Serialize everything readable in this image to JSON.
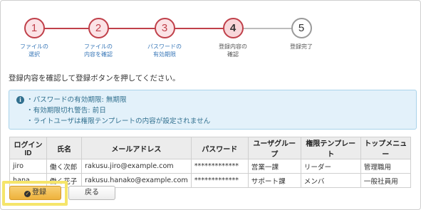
{
  "stepper": {
    "steps": [
      {
        "number": "1",
        "label": "ファイルの\n選択",
        "state": "past"
      },
      {
        "number": "2",
        "label": "ファイルの\n内容を確認",
        "state": "past"
      },
      {
        "number": "3",
        "label": "パスワードの\n有効期限",
        "state": "past"
      },
      {
        "number": "4",
        "label": "登録内容の\n確認",
        "state": "current"
      },
      {
        "number": "5",
        "label": "登録完了",
        "state": "future"
      }
    ]
  },
  "instruction": "登録内容を確認して登録ボタンを押してください。",
  "info": {
    "icon": "info-circle-icon",
    "items": [
      "・パスワードの有効期限: 無期限",
      "・有効期限切れ警告: 前日",
      "・ライトユーザは権限テンプレートの内容が設定されません"
    ]
  },
  "table": {
    "headers": [
      "ログインID",
      "氏名",
      "メールアドレス",
      "パスワード",
      "ユーザグループ",
      "権限テンプレート",
      "トップメニュー"
    ],
    "rows": [
      [
        "jiro",
        "働く次郎",
        "rakusu.jiro@example.com",
        "*************",
        "営業一課",
        "リーダー",
        "管理職用"
      ],
      [
        "hana",
        "働く花子",
        "rakusu.hanako@example.com",
        "*************",
        "サポート課",
        "メンバ",
        "一般社員用"
      ]
    ]
  },
  "buttons": {
    "register_label": "登録",
    "back_label": "戻る"
  },
  "colors": {
    "accent": "#c0404a",
    "link": "#3a78b8",
    "info_bg": "#e3f1fa",
    "info_text": "#31708f",
    "register_button": "#f3c452",
    "highlight": "#f5e56a"
  }
}
